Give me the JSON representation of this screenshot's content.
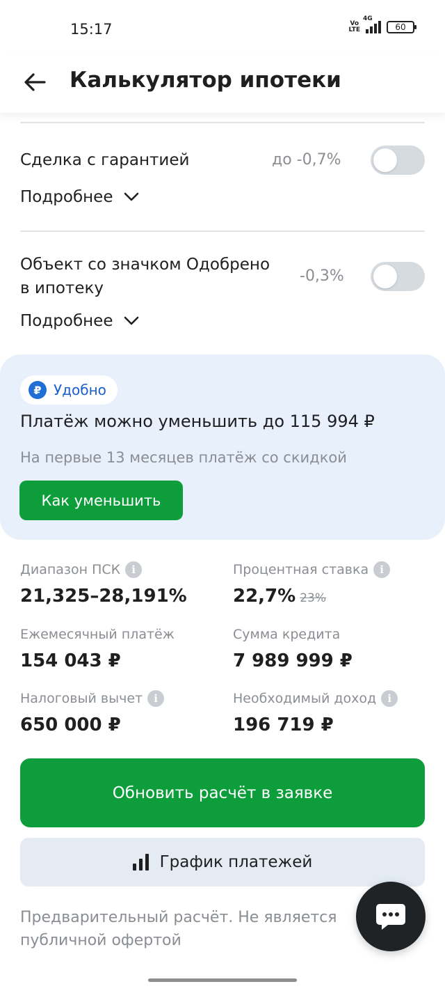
{
  "status_bar": {
    "time": "15:17",
    "volte": "Vo LTE",
    "network": "4G",
    "battery": "60"
  },
  "header": {
    "title": "Калькулятор ипотеки"
  },
  "options": [
    {
      "label": "Сделка с гарантией",
      "discount": "до -0,7%",
      "enabled": false,
      "more": "Подробнее"
    },
    {
      "label_line1": "Объект со значком Одобрено",
      "label_line2": "в ипотеку",
      "discount": "-0,3%",
      "enabled": false,
      "more": "Подробнее"
    }
  ],
  "promo": {
    "badge": "Удобно",
    "badge_icon": "ruble-icon",
    "title": "Платёж можно уменьшить до 115 994 ₽",
    "subtitle": "На первые 13 месяцев платёж со скидкой",
    "button": "Как уменьшить"
  },
  "stats": {
    "psk": {
      "label": "Диапазон ПСК",
      "value": "21,325–28,191%"
    },
    "rate": {
      "label": "Процентная ставка",
      "value": "22,7%",
      "old_value": "23%"
    },
    "monthly": {
      "label": "Ежемесячный платёж",
      "value": "154 043 ₽"
    },
    "loan": {
      "label": "Сумма кредита",
      "value": "7 989 999 ₽"
    },
    "tax": {
      "label": "Налоговый вычет",
      "value": "650 000 ₽"
    },
    "income": {
      "label": "Необходимый доход",
      "value": "196 719 ₽"
    }
  },
  "actions": {
    "update": "Обновить расчёт в заявке",
    "schedule": "График платежей"
  },
  "disclaimer": "Предварительный расчёт. Не является публичной офертой",
  "colors": {
    "primary_green": "#0d9e3b",
    "promo_bg": "#e8f0fb",
    "accent_blue": "#1f6fd6",
    "toggle_off": "#d6dbe0"
  }
}
